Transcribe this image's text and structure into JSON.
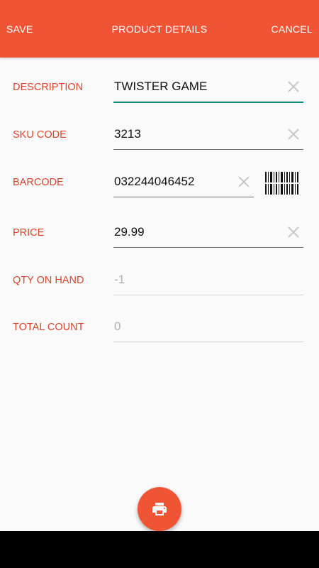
{
  "appbar": {
    "save_label": "SAVE",
    "title": "PRODUCT DETAILS",
    "cancel_label": "CANCEL",
    "color": "#ef5435"
  },
  "form": {
    "description": {
      "label": "DESCRIPTION",
      "value": "TWISTER GAME"
    },
    "sku": {
      "label": "SKU CODE",
      "value": "3213"
    },
    "barcode": {
      "label": "BARCODE",
      "value": "032244046452",
      "scan_icon": "barcode-icon"
    },
    "price": {
      "label": "PRICE",
      "value": "29.99"
    },
    "qty_on_hand": {
      "label": "QTY ON HAND",
      "value": "-1"
    },
    "total_count": {
      "label": "TOTAL COUNT",
      "value": "0"
    }
  },
  "fab": {
    "icon": "print-icon"
  },
  "colors": {
    "label": "#d8432a",
    "focus_underline": "#13897a"
  }
}
